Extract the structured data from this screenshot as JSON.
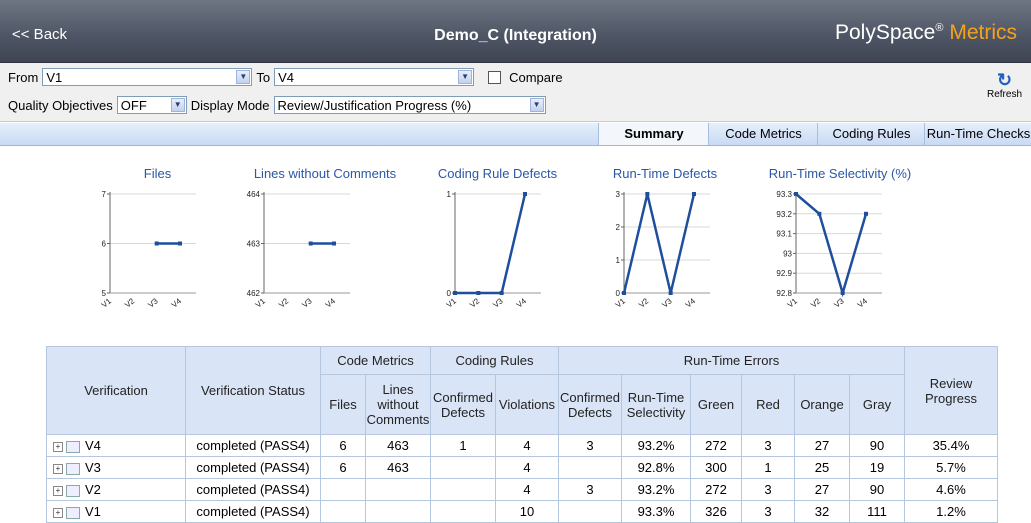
{
  "header": {
    "back": "<< Back",
    "title": "Demo_C (Integration)",
    "brand_main": "PolySpace",
    "brand_reg": "®",
    "brand_metrics": "Metrics"
  },
  "toolbar": {
    "from_label": "From",
    "from_value": "V1",
    "to_label": "To",
    "to_value": "V4",
    "compare_label": "Compare",
    "qo_label": "Quality Objectives",
    "qo_value": "OFF",
    "dm_label": "Display Mode",
    "dm_value": "Review/Justification Progress (%)",
    "refresh_label": "Refresh"
  },
  "tabs": [
    "Summary",
    "Code Metrics",
    "Coding Rules",
    "Run-Time Checks"
  ],
  "chart_data": [
    {
      "type": "line",
      "title": "Files",
      "categories": [
        "V1",
        "V2",
        "V3",
        "V4"
      ],
      "values": [
        null,
        null,
        6,
        6
      ],
      "yticks": [
        "5",
        "6",
        "7"
      ],
      "ylim": [
        5,
        7
      ]
    },
    {
      "type": "line",
      "title": "Lines without Comments",
      "categories": [
        "V1",
        "V2",
        "V3",
        "V4"
      ],
      "values": [
        null,
        null,
        463,
        463
      ],
      "yticks": [
        "462",
        "463",
        "464"
      ],
      "ylim": [
        462,
        464
      ]
    },
    {
      "type": "line",
      "title": "Coding Rule Defects",
      "categories": [
        "V1",
        "V2",
        "V3",
        "V4"
      ],
      "values": [
        0,
        0,
        0,
        1
      ],
      "yticks": [
        "0",
        "1"
      ],
      "ylim": [
        0,
        1
      ]
    },
    {
      "type": "line",
      "title": "Run-Time Defects",
      "categories": [
        "V1",
        "V2",
        "V3",
        "V4"
      ],
      "values": [
        0,
        3,
        0,
        3
      ],
      "yticks": [
        "0",
        "1",
        "2",
        "3"
      ],
      "ylim": [
        0,
        3
      ]
    },
    {
      "type": "line",
      "title": "Run-Time Selectivity (%)",
      "categories": [
        "V1",
        "V2",
        "V3",
        "V4"
      ],
      "values": [
        93.3,
        93.2,
        92.8,
        93.2
      ],
      "yticks": [
        "92.8",
        "92.9",
        "93",
        "93.1",
        "93.2",
        "93.3"
      ],
      "ylim": [
        92.8,
        93.3
      ]
    }
  ],
  "table": {
    "headers": {
      "verification": "Verification",
      "status": "Verification Status",
      "code_metrics": "Code Metrics",
      "coding_rules": "Coding Rules",
      "run_time_errors": "Run-Time Errors",
      "files": "Files",
      "lines": "Lines without Comments",
      "confirmed_defects": "Confirmed Defects",
      "violations": "Violations",
      "rt_confirmed": "Confirmed Defects",
      "selectivity": "Run-Time Selectivity",
      "green": "Green",
      "red": "Red",
      "orange": "Orange",
      "gray": "Gray",
      "review": "Review Progress"
    },
    "rows": [
      {
        "version": "V4",
        "status": "completed (PASS4)",
        "files": "6",
        "lines": "463",
        "confirmed": "1",
        "violations": "4",
        "rt_confirmed": "3",
        "selectivity": "93.2%",
        "green": "272",
        "red": "3",
        "orange": "27",
        "gray": "90",
        "review": "35.4%"
      },
      {
        "version": "V3",
        "status": "completed (PASS4)",
        "files": "6",
        "lines": "463",
        "confirmed": "",
        "violations": "4",
        "rt_confirmed": "",
        "selectivity": "92.8%",
        "green": "300",
        "red": "1",
        "orange": "25",
        "gray": "19",
        "review": "5.7%"
      },
      {
        "version": "V2",
        "status": "completed (PASS4)",
        "files": "",
        "lines": "",
        "confirmed": "",
        "violations": "4",
        "rt_confirmed": "3",
        "selectivity": "93.2%",
        "green": "272",
        "red": "3",
        "orange": "27",
        "gray": "90",
        "review": "4.6%"
      },
      {
        "version": "V1",
        "status": "completed (PASS4)",
        "files": "",
        "lines": "",
        "confirmed": "",
        "violations": "10",
        "rt_confirmed": "",
        "selectivity": "93.3%",
        "green": "326",
        "red": "3",
        "orange": "32",
        "gray": "111",
        "review": "1.2%"
      }
    ]
  },
  "colors": {
    "line": "#1f4e9c",
    "title": "#2a57a6"
  }
}
